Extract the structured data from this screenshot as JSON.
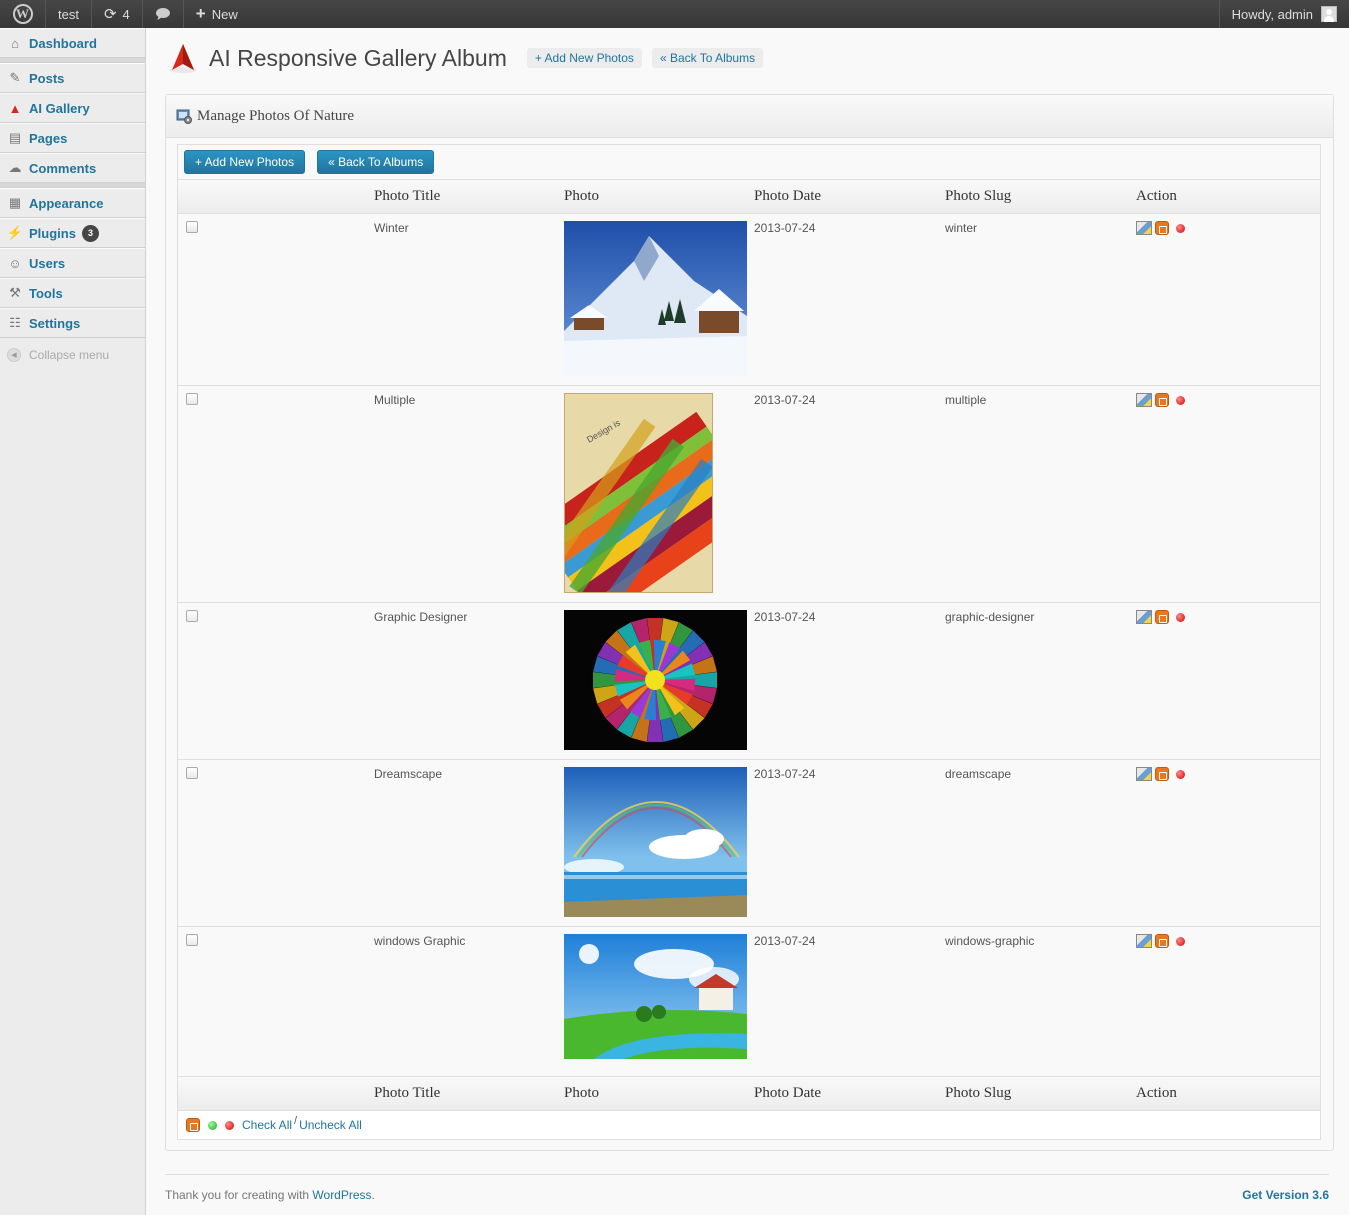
{
  "adminbar": {
    "site": "test",
    "updates_count": "4",
    "new_label": "New",
    "greeting": "Howdy, admin"
  },
  "sidebar": {
    "items": [
      {
        "label": "Dashboard",
        "icon": "dashboard-icon"
      },
      {
        "label": "Posts",
        "icon": "pin-icon"
      },
      {
        "label": "AI Gallery",
        "icon": "ai-gallery-icon"
      },
      {
        "label": "Pages",
        "icon": "pages-icon"
      },
      {
        "label": "Comments",
        "icon": "comments-icon"
      },
      {
        "label": "Appearance",
        "icon": "appearance-icon"
      },
      {
        "label": "Plugins",
        "icon": "plugins-icon",
        "badge": "3"
      },
      {
        "label": "Users",
        "icon": "users-icon"
      },
      {
        "label": "Tools",
        "icon": "tools-icon"
      },
      {
        "label": "Settings",
        "icon": "settings-icon"
      }
    ],
    "collapse": "Collapse menu"
  },
  "header": {
    "title": "AI Responsive Gallery Album",
    "add_new": "+ Add New Photos",
    "back": "« Back To Albums"
  },
  "box": {
    "title": "Manage Photos Of Nature",
    "add_btn": "+ Add New Photos",
    "back_btn": "« Back To Albums"
  },
  "table": {
    "columns": [
      "Photo Title",
      "Photo",
      "Photo Date",
      "Photo Slug",
      "Action"
    ],
    "rows": [
      {
        "title": "Winter",
        "date": "2013-07-24",
        "slug": "winter",
        "thumb": "winter"
      },
      {
        "title": "Multiple",
        "date": "2013-07-24",
        "slug": "multiple",
        "thumb": "multiple"
      },
      {
        "title": "Graphic Designer",
        "date": "2013-07-24",
        "slug": "graphic-designer",
        "thumb": "graphic"
      },
      {
        "title": "Dreamscape",
        "date": "2013-07-24",
        "slug": "dreamscape",
        "thumb": "dreamscape"
      },
      {
        "title": "windows Graphic",
        "date": "2013-07-24",
        "slug": "windows-graphic",
        "thumb": "windows"
      }
    ]
  },
  "bulk": {
    "check_all": "Check All",
    "separator": "/",
    "uncheck_all": "Uncheck All"
  },
  "footer": {
    "thanks_prefix": "Thank you for creating with ",
    "wp_link": "WordPress",
    "thanks_suffix": ".",
    "version": "Get Version 3.6"
  },
  "colors": {
    "link": "#21759b",
    "adminbar": "#464646",
    "primary_button": "#21759b"
  }
}
